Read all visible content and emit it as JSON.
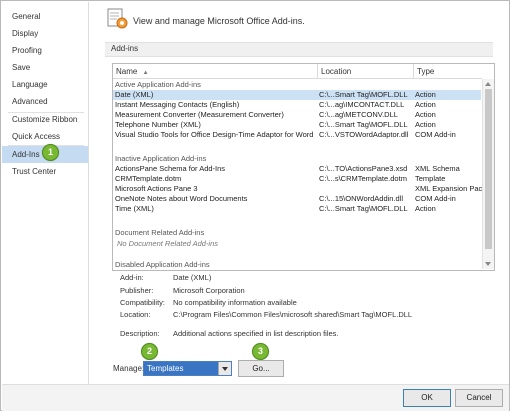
{
  "sidebar": {
    "items": [
      {
        "label": "General"
      },
      {
        "label": "Display"
      },
      {
        "label": "Proofing"
      },
      {
        "label": "Save"
      },
      {
        "label": "Language"
      },
      {
        "label": "Advanced"
      },
      {
        "label": "Customize Ribbon"
      },
      {
        "label": "Quick Access Toolbar"
      },
      {
        "label": "Add-Ins"
      },
      {
        "label": "Trust Center"
      }
    ],
    "selected": "Add-Ins"
  },
  "callouts": [
    "1",
    "2",
    "3"
  ],
  "header": {
    "title": "View and manage Microsoft Office Add-ins.",
    "section": "Add-ins"
  },
  "table": {
    "columns": [
      "Name",
      "Location",
      "Type"
    ],
    "sort_indicator": "▲",
    "groups": [
      {
        "title": "Active Application Add-ins",
        "rows": [
          {
            "name": "Date (XML)",
            "location": "C:\\...Smart Tag\\MOFL.DLL",
            "type": "Action"
          },
          {
            "name": "Instant Messaging Contacts (English)",
            "location": "C:\\...ag\\IMCONTACT.DLL",
            "type": "Action"
          },
          {
            "name": "Measurement Converter (Measurement Converter)",
            "location": "C:\\...ag\\METCONV.DLL",
            "type": "Action"
          },
          {
            "name": "Telephone Number (XML)",
            "location": "C:\\...Smart Tag\\MOFL.DLL",
            "type": "Action"
          },
          {
            "name": "Visual Studio Tools for Office Design-Time Adaptor for Word",
            "location": "C:\\...VSTOWordAdaptor.dll",
            "type": "COM Add-in"
          }
        ]
      },
      {
        "title": "Inactive Application Add-ins",
        "rows": [
          {
            "name": "ActionsPane Schema for Add-Ins",
            "location": "C:\\...TO\\ActionsPane3.xsd",
            "type": "XML Schema"
          },
          {
            "name": "CRMTemplate.dotm",
            "location": "C:\\...s\\CRMTemplate.dotm",
            "type": "Template"
          },
          {
            "name": "Microsoft Actions Pane 3",
            "location": "",
            "type": "XML Expansion Pack"
          },
          {
            "name": "OneNote Notes about Word Documents",
            "location": "C:\\...15\\ONWordAddin.dll",
            "type": "COM Add-in"
          },
          {
            "name": "Time (XML)",
            "location": "C:\\...Smart Tag\\MOFL.DLL",
            "type": "Action"
          }
        ]
      },
      {
        "title": "Document Related Add-ins",
        "empty_text": "No Document Related Add-ins"
      },
      {
        "title": "Disabled Application Add-ins"
      }
    ]
  },
  "details": {
    "addin_label": "Add-in:",
    "addin_value": "Date (XML)",
    "publisher_label": "Publisher:",
    "publisher_value": "Microsoft Corporation",
    "compat_label": "Compatibility:",
    "compat_value": "No compatibility information available",
    "location_label": "Location:",
    "location_value": "C:\\Program Files\\Common Files\\microsoft shared\\Smart Tag\\MOFL.DLL",
    "description_label": "Description:",
    "description_value": "Additional actions specified in list description files."
  },
  "manage": {
    "label": "Manage:",
    "selected": "Templates",
    "go_label": "Go..."
  },
  "footer": {
    "ok_label": "OK",
    "cancel_label": "Cancel"
  },
  "colors": {
    "selection": "#cde1f5",
    "sidebar_selection": "#c5dbf1",
    "callout": "#78b832",
    "dropdown_highlight": "#3a75c4"
  }
}
